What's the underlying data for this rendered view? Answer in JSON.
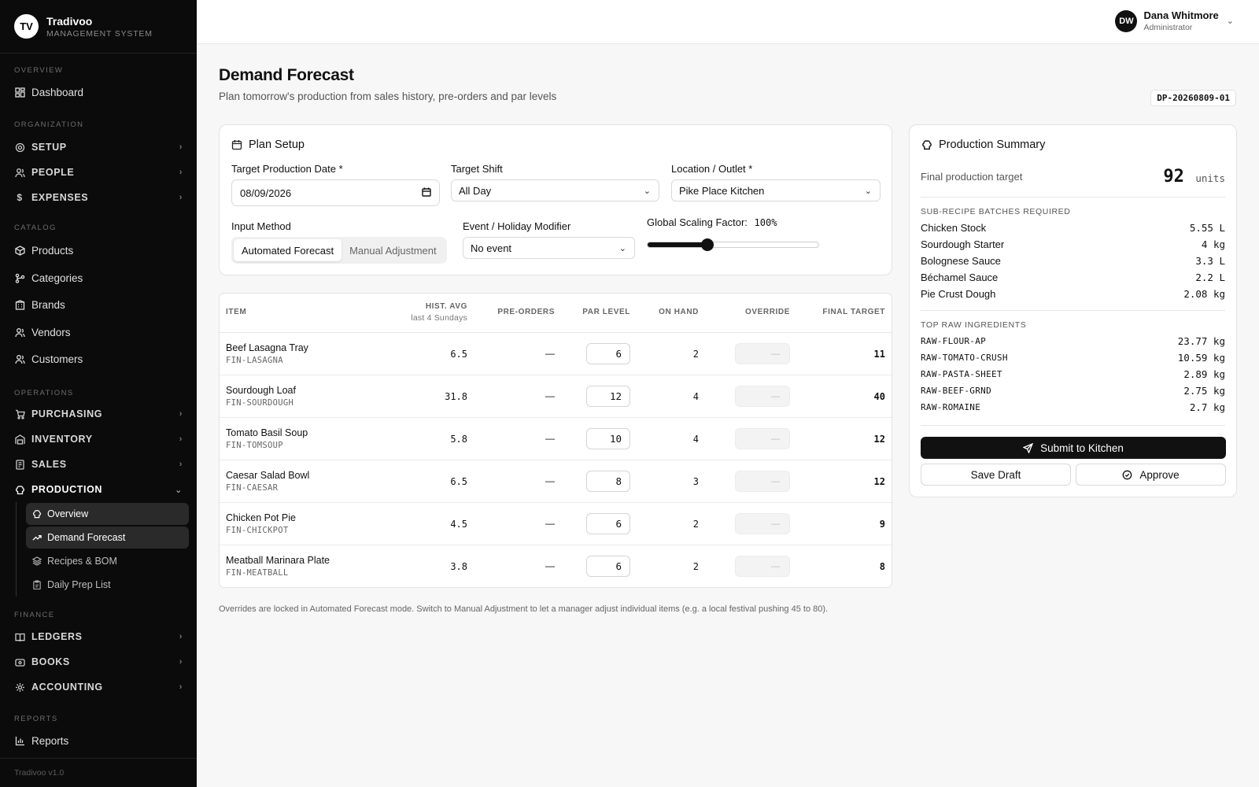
{
  "brand": {
    "initials": "TV",
    "name": "Tradivoo",
    "subtitle": "MANAGEMENT SYSTEM"
  },
  "sidebar": {
    "sections": {
      "overview": "OVERVIEW",
      "organization": "ORGANIZATION",
      "catalog": "CATALOG",
      "operations": "OPERATIONS",
      "finance": "FINANCE",
      "reports": "REPORTS"
    },
    "items": {
      "dashboard": "Dashboard",
      "setup": "SETUP",
      "people": "PEOPLE",
      "expenses": "EXPENSES",
      "products": "Products",
      "categories": "Categories",
      "brands": "Brands",
      "vendors": "Vendors",
      "customers": "Customers",
      "purchasing": "PURCHASING",
      "inventory": "INVENTORY",
      "sales": "SALES",
      "production": "PRODUCTION",
      "ledgers": "LEDGERS",
      "books": "BOOKS",
      "accounting": "ACCOUNTING",
      "reports": "Reports"
    },
    "production_sub": {
      "overview": "Overview",
      "demand_forecast": "Demand Forecast",
      "recipes_bom": "Recipes & BOM",
      "daily_prep": "Daily Prep List"
    },
    "version": "Tradivoo v1.0"
  },
  "user": {
    "initials": "DW",
    "name": "Dana Whitmore",
    "role": "Administrator"
  },
  "page": {
    "title": "Demand Forecast",
    "subtitle": "Plan tomorrow's production from sales history, pre-orders and par levels",
    "doc_id": "DP-20260809-01"
  },
  "plan_setup": {
    "title": "Plan Setup",
    "date_label": "Target Production Date *",
    "date_value": "08/09/2026",
    "shift_label": "Target Shift",
    "shift_value": "All Day",
    "location_label": "Location / Outlet *",
    "location_value": "Pike Place Kitchen",
    "method_label": "Input Method",
    "method_options": [
      "Automated Forecast",
      "Manual Adjustment"
    ],
    "method_selected": "Automated Forecast",
    "event_label": "Event / Holiday Modifier",
    "event_value": "No event",
    "scaling_label": "Global Scaling Factor:",
    "scaling_value": "100%",
    "scaling_fraction": 0.35
  },
  "table": {
    "headers": {
      "item": "ITEM",
      "hist": "HIST. AVG",
      "hist_sub": "last 4 Sundays",
      "pre": "PRE-ORDERS",
      "par": "PAR LEVEL",
      "onhand": "ON HAND",
      "override": "OVERRIDE",
      "final": "FINAL TARGET"
    },
    "rows": [
      {
        "name": "Beef Lasagna Tray",
        "sku": "FIN-LASAGNA",
        "hist": "6.5",
        "pre": "—",
        "par": "6",
        "onhand": "2",
        "override": "—",
        "final": "11"
      },
      {
        "name": "Sourdough Loaf",
        "sku": "FIN-SOURDOUGH",
        "hist": "31.8",
        "pre": "—",
        "par": "12",
        "onhand": "4",
        "override": "—",
        "final": "40"
      },
      {
        "name": "Tomato Basil Soup",
        "sku": "FIN-TOMSOUP",
        "hist": "5.8",
        "pre": "—",
        "par": "10",
        "onhand": "4",
        "override": "—",
        "final": "12"
      },
      {
        "name": "Caesar Salad Bowl",
        "sku": "FIN-CAESAR",
        "hist": "6.5",
        "pre": "—",
        "par": "8",
        "onhand": "3",
        "override": "—",
        "final": "12"
      },
      {
        "name": "Chicken Pot Pie",
        "sku": "FIN-CHICKPOT",
        "hist": "4.5",
        "pre": "—",
        "par": "6",
        "onhand": "2",
        "override": "—",
        "final": "9"
      },
      {
        "name": "Meatball Marinara Plate",
        "sku": "FIN-MEATBALL",
        "hist": "3.8",
        "pre": "—",
        "par": "6",
        "onhand": "2",
        "override": "—",
        "final": "8"
      }
    ],
    "note": "Overrides are locked in Automated Forecast mode. Switch to Manual Adjustment to let a manager adjust individual items (e.g. a local festival pushing 45 to 80)."
  },
  "summary": {
    "title": "Production Summary",
    "target_label": "Final production target",
    "target_value": "92",
    "target_unit": "units",
    "subrecipe_head": "SUB-RECIPE BATCHES REQUIRED",
    "subrecipes": [
      {
        "name": "Chicken Stock",
        "qty": "5.55 L"
      },
      {
        "name": "Sourdough Starter",
        "qty": "4 kg"
      },
      {
        "name": "Bolognese Sauce",
        "qty": "3.3 L"
      },
      {
        "name": "Béchamel Sauce",
        "qty": "2.2 L"
      },
      {
        "name": "Pie Crust Dough",
        "qty": "2.08 kg"
      }
    ],
    "raw_head": "TOP RAW INGREDIENTS",
    "raw": [
      {
        "code": "RAW-FLOUR-AP",
        "qty": "23.77 kg"
      },
      {
        "code": "RAW-TOMATO-CRUSH",
        "qty": "10.59 kg"
      },
      {
        "code": "RAW-PASTA-SHEET",
        "qty": "2.89 kg"
      },
      {
        "code": "RAW-BEEF-GRND",
        "qty": "2.75 kg"
      },
      {
        "code": "RAW-ROMAINE",
        "qty": "2.7 kg"
      }
    ],
    "submit_label": "Submit to Kitchen",
    "draft_label": "Save Draft",
    "approve_label": "Approve"
  }
}
